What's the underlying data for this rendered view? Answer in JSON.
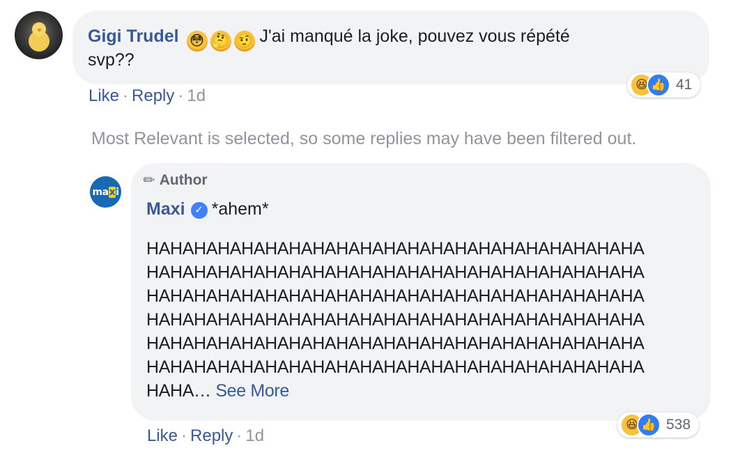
{
  "comment": {
    "author": "Gigi Trudel",
    "emojis": [
      "😳",
      "🤔",
      "🤨"
    ],
    "text_line1": "J'ai manqué la joke, pouvez vous répété",
    "text_line2": "svp??",
    "reactions": {
      "icons": [
        "haha-icon",
        "like-icon"
      ],
      "count": "41"
    },
    "actions": {
      "like": "Like",
      "reply": "Reply",
      "time": "1d"
    }
  },
  "filter_note": "Most Relevant is selected, so some replies may have been filtered out.",
  "reply": {
    "badge": "Author",
    "author": "Maxi",
    "header_text": "*ahem*",
    "body_lines": [
      "HAHAHAHAHAHAHAHAHAHAHAHAHAHAHAHAHAHAHAHAHA",
      "HAHAHAHAHAHAHAHAHAHAHAHAHAHAHAHAHAHAHAHAHA",
      "HAHAHAHAHAHAHAHAHAHAHAHAHAHAHAHAHAHAHAHAHA",
      "HAHAHAHAHAHAHAHAHAHAHAHAHAHAHAHAHAHAHAHAHA",
      "HAHAHAHAHAHAHAHAHAHAHAHAHAHAHAHAHAHAHAHAHA",
      "HAHAHAHAHAHAHAHAHAHAHAHAHAHAHAHAHAHAHAHAHA"
    ],
    "last_line": "HAHA…",
    "see_more": "See More",
    "reactions": {
      "icons": [
        "haha-icon",
        "like-icon"
      ],
      "count": "538"
    },
    "actions": {
      "like": "Like",
      "reply": "Reply",
      "time": "1d"
    }
  },
  "avatar_logo": "maxi",
  "colors": {
    "link": "#385898",
    "muted": "#90949c",
    "bubble": "#f2f3f5",
    "maxi_blue": "#1669b5"
  }
}
